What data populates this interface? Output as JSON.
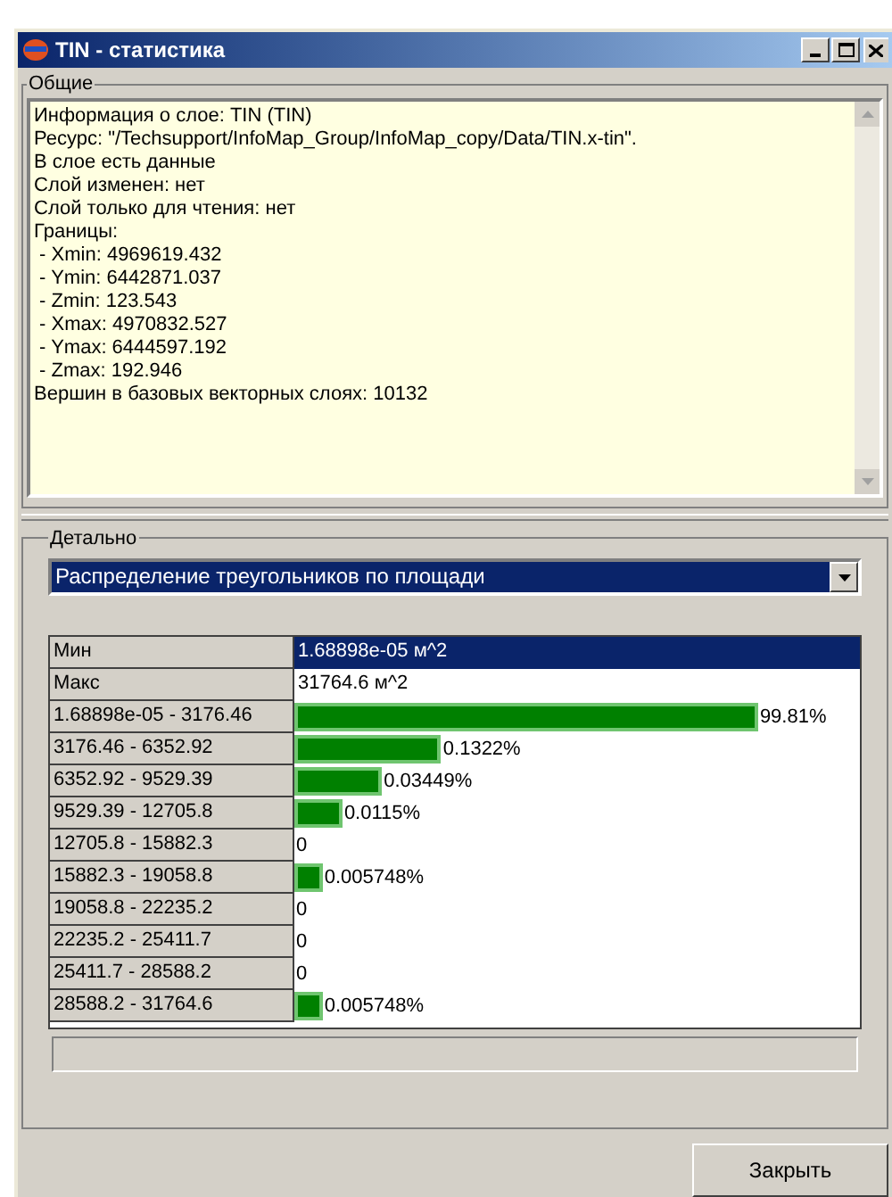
{
  "window": {
    "title": "TIN - статистика"
  },
  "general": {
    "label": "Общие",
    "lines": [
      "Информация о слое: TIN (TIN)",
      "Ресурс: \"/Techsupport/InfoMap_Group/InfoMap_copy/Data/TIN.x-tin\".",
      "В слое есть данные",
      "Слой изменен: нет",
      "Слой только для чтения: нет",
      "Границы:",
      " - Xmin: 4969619.432",
      " - Ymin: 6442871.037",
      " - Zmin: 123.543",
      " - Xmax: 4970832.527",
      " - Ymax: 6444597.192",
      " - Zmax: 192.946",
      "Вершин в базовых векторных слоях: 10132"
    ]
  },
  "detail": {
    "label": "Детально",
    "dropdown": {
      "value": "Распределение треугольников по площади"
    },
    "rows": [
      {
        "kind": "value",
        "label": "Мин",
        "value": "1.68898e-05 м^2",
        "selected": true
      },
      {
        "kind": "value",
        "label": "Макс",
        "value": "31764.6 м^2",
        "selected": false
      },
      {
        "kind": "bar",
        "label": "1.68898e-05 - 3176.46",
        "level": 0.82,
        "reading": "99.81%",
        "selected": false
      },
      {
        "kind": "bar",
        "label": "3176.46 - 6352.92",
        "level": 0.26,
        "reading": "0.1322%",
        "selected": false
      },
      {
        "kind": "bar",
        "label": "6352.92 - 9529.39",
        "level": 0.155,
        "reading": "0.03449%",
        "selected": false
      },
      {
        "kind": "bar",
        "label": "9529.39 - 12705.8",
        "level": 0.085,
        "reading": "0.0115%",
        "selected": false
      },
      {
        "kind": "bar",
        "label": "12705.8 - 15882.3",
        "reading": "0",
        "selected": false
      },
      {
        "kind": "bar",
        "label": "15882.3 - 19058.8",
        "level": 0.05,
        "reading": "0.005748%",
        "selected": false
      },
      {
        "kind": "bar",
        "label": "19058.8 - 22235.2",
        "reading": "0",
        "selected": false
      },
      {
        "kind": "bar",
        "label": "22235.2 - 25411.7",
        "reading": "0",
        "selected": false
      },
      {
        "kind": "bar",
        "label": "25411.7 - 28588.2",
        "reading": "0",
        "selected": false
      },
      {
        "kind": "bar",
        "label": "28588.2 - 31764.6",
        "level": 0.05,
        "reading": "0.005748%",
        "selected": false
      }
    ]
  },
  "buttons": [
    "Закрыть"
  ]
}
